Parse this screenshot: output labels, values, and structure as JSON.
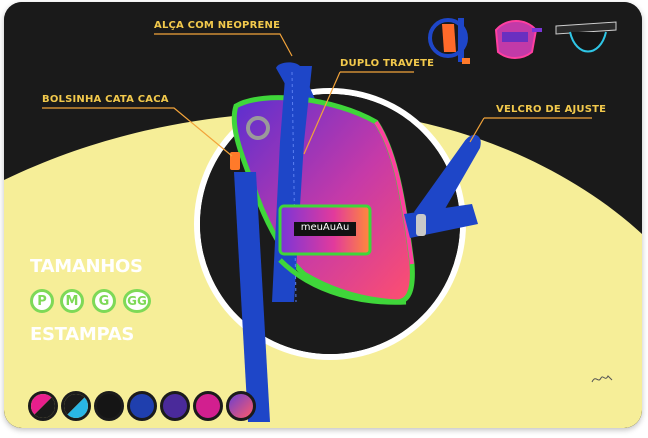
{
  "callouts": {
    "strap": "ALÇA COM NEOPRENE",
    "bartack": "DUPLO TRAVETE",
    "pouch": "BOLSINHA CATA CACA",
    "velcro": "VELCRO DE AJUSTE"
  },
  "product": {
    "logo": "meuAuAu"
  },
  "sizes": {
    "title": "TAMANHOS",
    "options": [
      "P",
      "M",
      "G",
      "GG"
    ]
  },
  "prints": {
    "title": "ESTAMPAS",
    "swatches": [
      {
        "name": "black-pink",
        "colors": [
          "#e91e8c",
          "#1a1a1a"
        ]
      },
      {
        "name": "black-cyan",
        "colors": [
          "#1a1a1a",
          "#29b6e6"
        ]
      },
      {
        "name": "black",
        "colors": [
          "#151515",
          "#151515"
        ]
      },
      {
        "name": "blue",
        "colors": [
          "#1f3fae",
          "#1f3fae"
        ]
      },
      {
        "name": "purple",
        "colors": [
          "#4a2a9a",
          "#4a2a9a"
        ]
      },
      {
        "name": "magenta",
        "colors": [
          "#d21f8f",
          "#d21f8f"
        ]
      },
      {
        "name": "gradient",
        "colors": [
          "#6a3fd0",
          "#ff5a6a"
        ]
      }
    ]
  },
  "colors": {
    "background_dark": "#1a1a1a",
    "background_yellow": "#f6ee98",
    "callout_text": "#f2c94c",
    "callout_line": "#f2a33a",
    "accent_green": "#7ed957",
    "strap_blue": "#1e46c8"
  }
}
